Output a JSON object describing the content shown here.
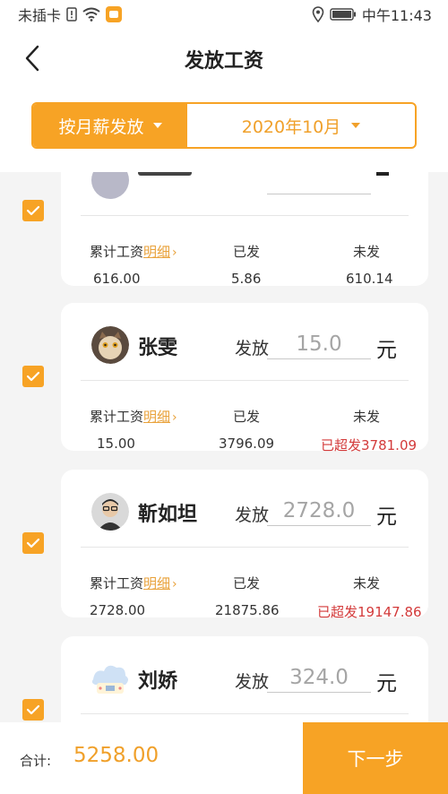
{
  "status_bar": {
    "carrier": "未插卡",
    "time": "中午11:43"
  },
  "header": {
    "title": "发放工资",
    "filter_type": "按月薪发放",
    "filter_month": "2020年10月"
  },
  "accent_color": "#f7a325",
  "card_labels": {
    "cumulative": "累计工资",
    "detail": "明细",
    "paid": "已发",
    "unpaid": "未发",
    "issue": "发放",
    "yuan": "元"
  },
  "employees": [
    {
      "cumulative": "616.00",
      "paid": "5.86",
      "unpaid": "610.14"
    },
    {
      "name": "张雯",
      "amount": "15.0",
      "cumulative": "15.00",
      "paid": "3796.09",
      "unpaid": "已超发3781.09"
    },
    {
      "name": "靳如坦",
      "amount": "2728.0",
      "cumulative": "2728.00",
      "paid": "21875.86",
      "unpaid": "已超发19147.86"
    },
    {
      "name": "刘娇",
      "amount": "324.0"
    }
  ],
  "footer": {
    "total_label": "合计:",
    "total_value": "5258.00",
    "next_label": "下一步"
  }
}
